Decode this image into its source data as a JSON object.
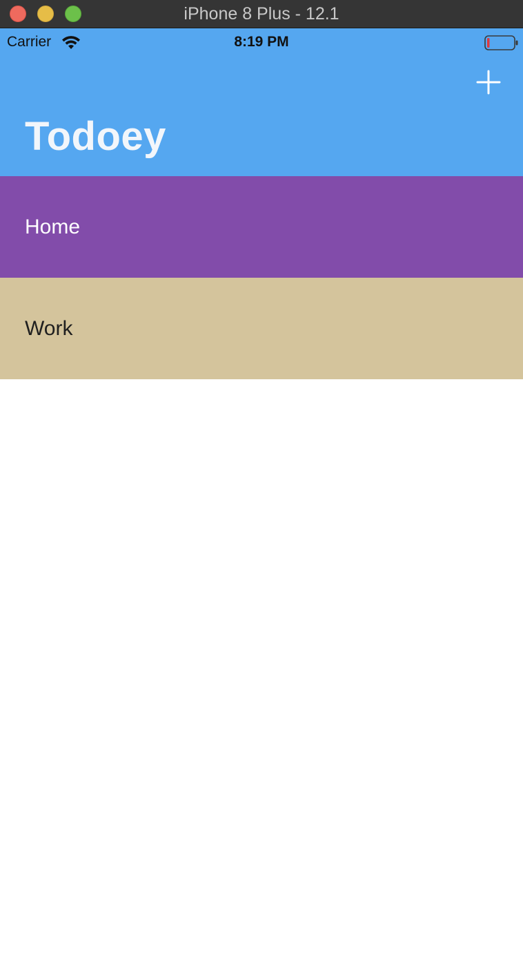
{
  "window": {
    "title": "iPhone 8 Plus - 12.1"
  },
  "status_bar": {
    "carrier": "Carrier",
    "time": "8:19 PM",
    "icons": [
      "wifi-icon",
      "battery-icon"
    ]
  },
  "nav": {
    "title": "Todoey",
    "add_button_icon": "plus-icon"
  },
  "categories": [
    {
      "name": "Home",
      "color": "#824caa"
    },
    {
      "name": "Work",
      "color": "#d4c49c"
    }
  ],
  "colors": {
    "nav_background": "#55a7f0",
    "title_text": "#f2f6fb"
  }
}
